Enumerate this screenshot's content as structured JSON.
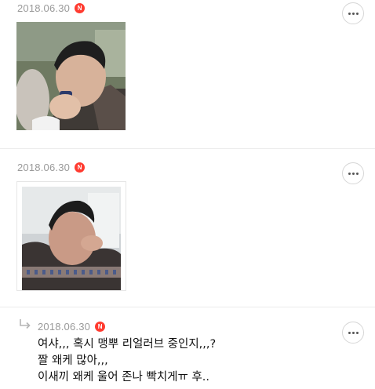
{
  "comments": [
    {
      "date": "2018.06.30",
      "badge": "N",
      "image_desc_icon": "photo-icon"
    },
    {
      "date": "2018.06.30",
      "badge": "N",
      "image_desc_icon": "photo-icon"
    },
    {
      "date": "2018.06.30",
      "badge": "N",
      "is_reply": true,
      "lines": [
        "여샤,,, 혹시 맹뿌 리얼러브 중인지,,,?",
        "짤 왜케 많아,,,",
        "이새끼 왜케 울어 존나 빡치게ㅠ 후.."
      ]
    }
  ],
  "colors": {
    "badge": "#ff3b30",
    "date": "#9a9a9a",
    "divider": "#ececec"
  }
}
